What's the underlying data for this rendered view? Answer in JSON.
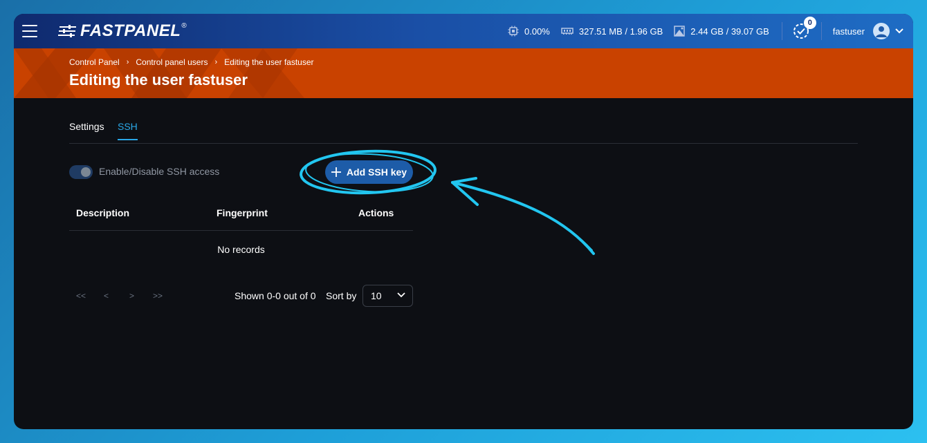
{
  "app": {
    "logo_text": "FASTPANEL",
    "logo_reg": "®"
  },
  "topbar": {
    "cpu": "0.00%",
    "memory": "327.51 MB / 1.96 GB",
    "disk": "2.44 GB / 39.07 GB",
    "notifications_count": "0",
    "username": "fastuser",
    "icons": [
      "menu-icon",
      "cpu-icon",
      "memory-icon",
      "disk-icon",
      "notification-check-icon",
      "user-avatar-icon",
      "chevron-down-icon"
    ]
  },
  "banner": {
    "breadcrumb": [
      "Control Panel",
      "Control panel users",
      "Editing the user fastuser"
    ],
    "separator": "›",
    "title": "Editing the user fastuser"
  },
  "tabs": [
    {
      "label": "Settings",
      "active": false
    },
    {
      "label": "SSH",
      "active": true
    }
  ],
  "ssh": {
    "toggle_label": "Enable/Disable SSH access",
    "toggle_enabled": false,
    "add_button_label": "Add SSH key",
    "table": {
      "headers": [
        "Description",
        "Fingerprint",
        "Actions"
      ],
      "empty_text": "No records"
    },
    "pagination": {
      "first": "<<",
      "prev": "<",
      "next": ">",
      "last": ">>",
      "shown_text": "Shown 0-0 out of 0",
      "sort_label": "Sort by",
      "page_size": "10"
    }
  },
  "colors": {
    "topbar_start": "#0f2a6e",
    "topbar_end": "#1e6cc4",
    "banner": "#c94200",
    "background": "#0d0f14",
    "accent": "#2aa8e8",
    "button": "#1d5ca8",
    "annotation": "#22c6f0"
  }
}
